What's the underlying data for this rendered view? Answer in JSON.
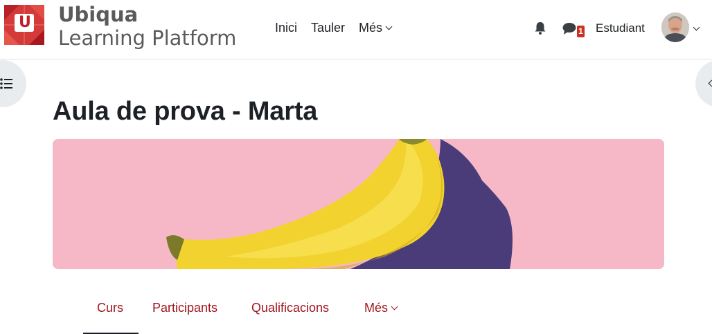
{
  "brand": {
    "line1": "Ubiqua",
    "line2": "Learning Platform",
    "logo_letter": "U",
    "logo_color": "#c0202a"
  },
  "primary_nav": {
    "items": [
      {
        "label": "Inici"
      },
      {
        "label": "Tauler"
      },
      {
        "label": "Més",
        "has_dropdown": true
      }
    ]
  },
  "user_menu": {
    "notifications_icon": "bell-icon",
    "messages_icon": "chat-icon",
    "messages_count": "1",
    "username": "Estudiant"
  },
  "page": {
    "title": "Aula de prova - Marta"
  },
  "banner": {
    "description_icon": "banana-image",
    "background": "#f6b8c6",
    "shadow": "#4a3c78",
    "fruit": "#f2d22e"
  },
  "secondary_nav": {
    "tabs": [
      {
        "label": "Curs",
        "active": true
      },
      {
        "label": "Participants"
      },
      {
        "label": "Qualificacions"
      },
      {
        "label": "Més",
        "has_dropdown": true
      }
    ]
  },
  "colors": {
    "accent": "#a0141e",
    "badge": "#ca3120"
  }
}
